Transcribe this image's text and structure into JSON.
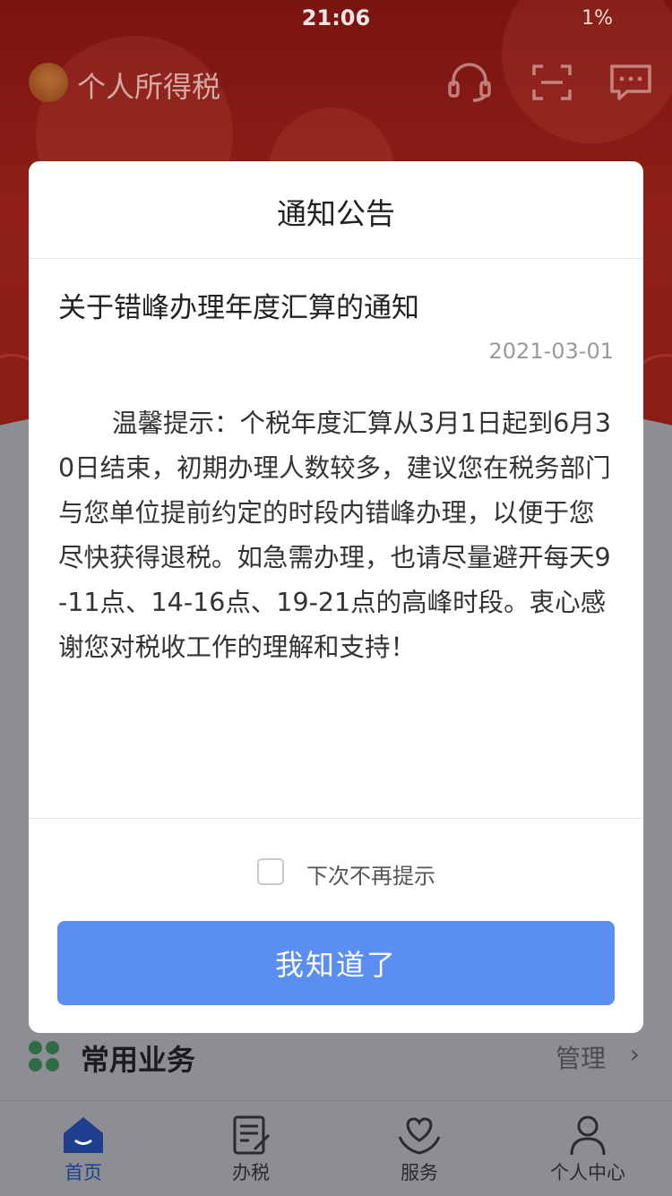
{
  "status_bar": {
    "time": "21:06",
    "battery": "1%",
    "signal_text": ""
  },
  "app": {
    "title": "个人所得税"
  },
  "header_icons": [
    "headset-icon",
    "scan-icon",
    "message-icon"
  ],
  "modal": {
    "title": "通知公告",
    "notice_title": "关于错峰办理年度汇算的通知",
    "date": "2021-03-01",
    "body": "温馨提示：个税年度汇算从3月1日起到6月30日结束，初期办理人数较多，建议您在税务部门与您单位提前约定的时段内错峰办理，以便于您尽快获得退税。如急需办理，也请尽量避开每天9-11点、14-16点、19-21点的高峰时段。衷心感谢您对税收工作的理解和支持！",
    "dont_show_again": "下次不再提示",
    "dont_show_again_checked": false,
    "confirm_button": "我知道了"
  },
  "common": {
    "title": "常用业务",
    "manage": "管理"
  },
  "tabbar": {
    "items": [
      {
        "label": "首页",
        "icon": "home-icon",
        "active": true
      },
      {
        "label": "办税",
        "icon": "document-edit-icon",
        "active": false
      },
      {
        "label": "服务",
        "icon": "heart-hands-icon",
        "active": false
      },
      {
        "label": "个人中心",
        "icon": "person-icon",
        "active": false
      }
    ]
  },
  "colors": {
    "brand_red": "#8f1f18",
    "primary_button": "#5b8ef1",
    "active_tab": "#1e3f8f"
  }
}
